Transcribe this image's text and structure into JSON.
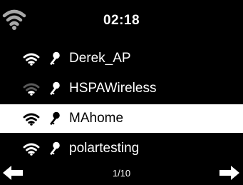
{
  "status": {
    "time": "02:18",
    "wifi_icon": "wifi-signal-icon"
  },
  "networks": [
    {
      "ssid": "Derek_AP",
      "signal": 3,
      "secured": true,
      "selected": false
    },
    {
      "ssid": "HSPAWireless",
      "signal": 1,
      "secured": true,
      "selected": false
    },
    {
      "ssid": "MAhome",
      "signal": 3,
      "secured": true,
      "selected": true
    },
    {
      "ssid": "polartesting",
      "signal": 3,
      "secured": true,
      "selected": false
    }
  ],
  "footer": {
    "page": "1/10",
    "prev_icon": "arrow-left-icon",
    "next_icon": "arrow-right-icon"
  },
  "colors": {
    "background": "#000000",
    "foreground": "#ffffff",
    "dim_signal": "#5a5a5a",
    "status_icon": "#a8a8a8"
  }
}
